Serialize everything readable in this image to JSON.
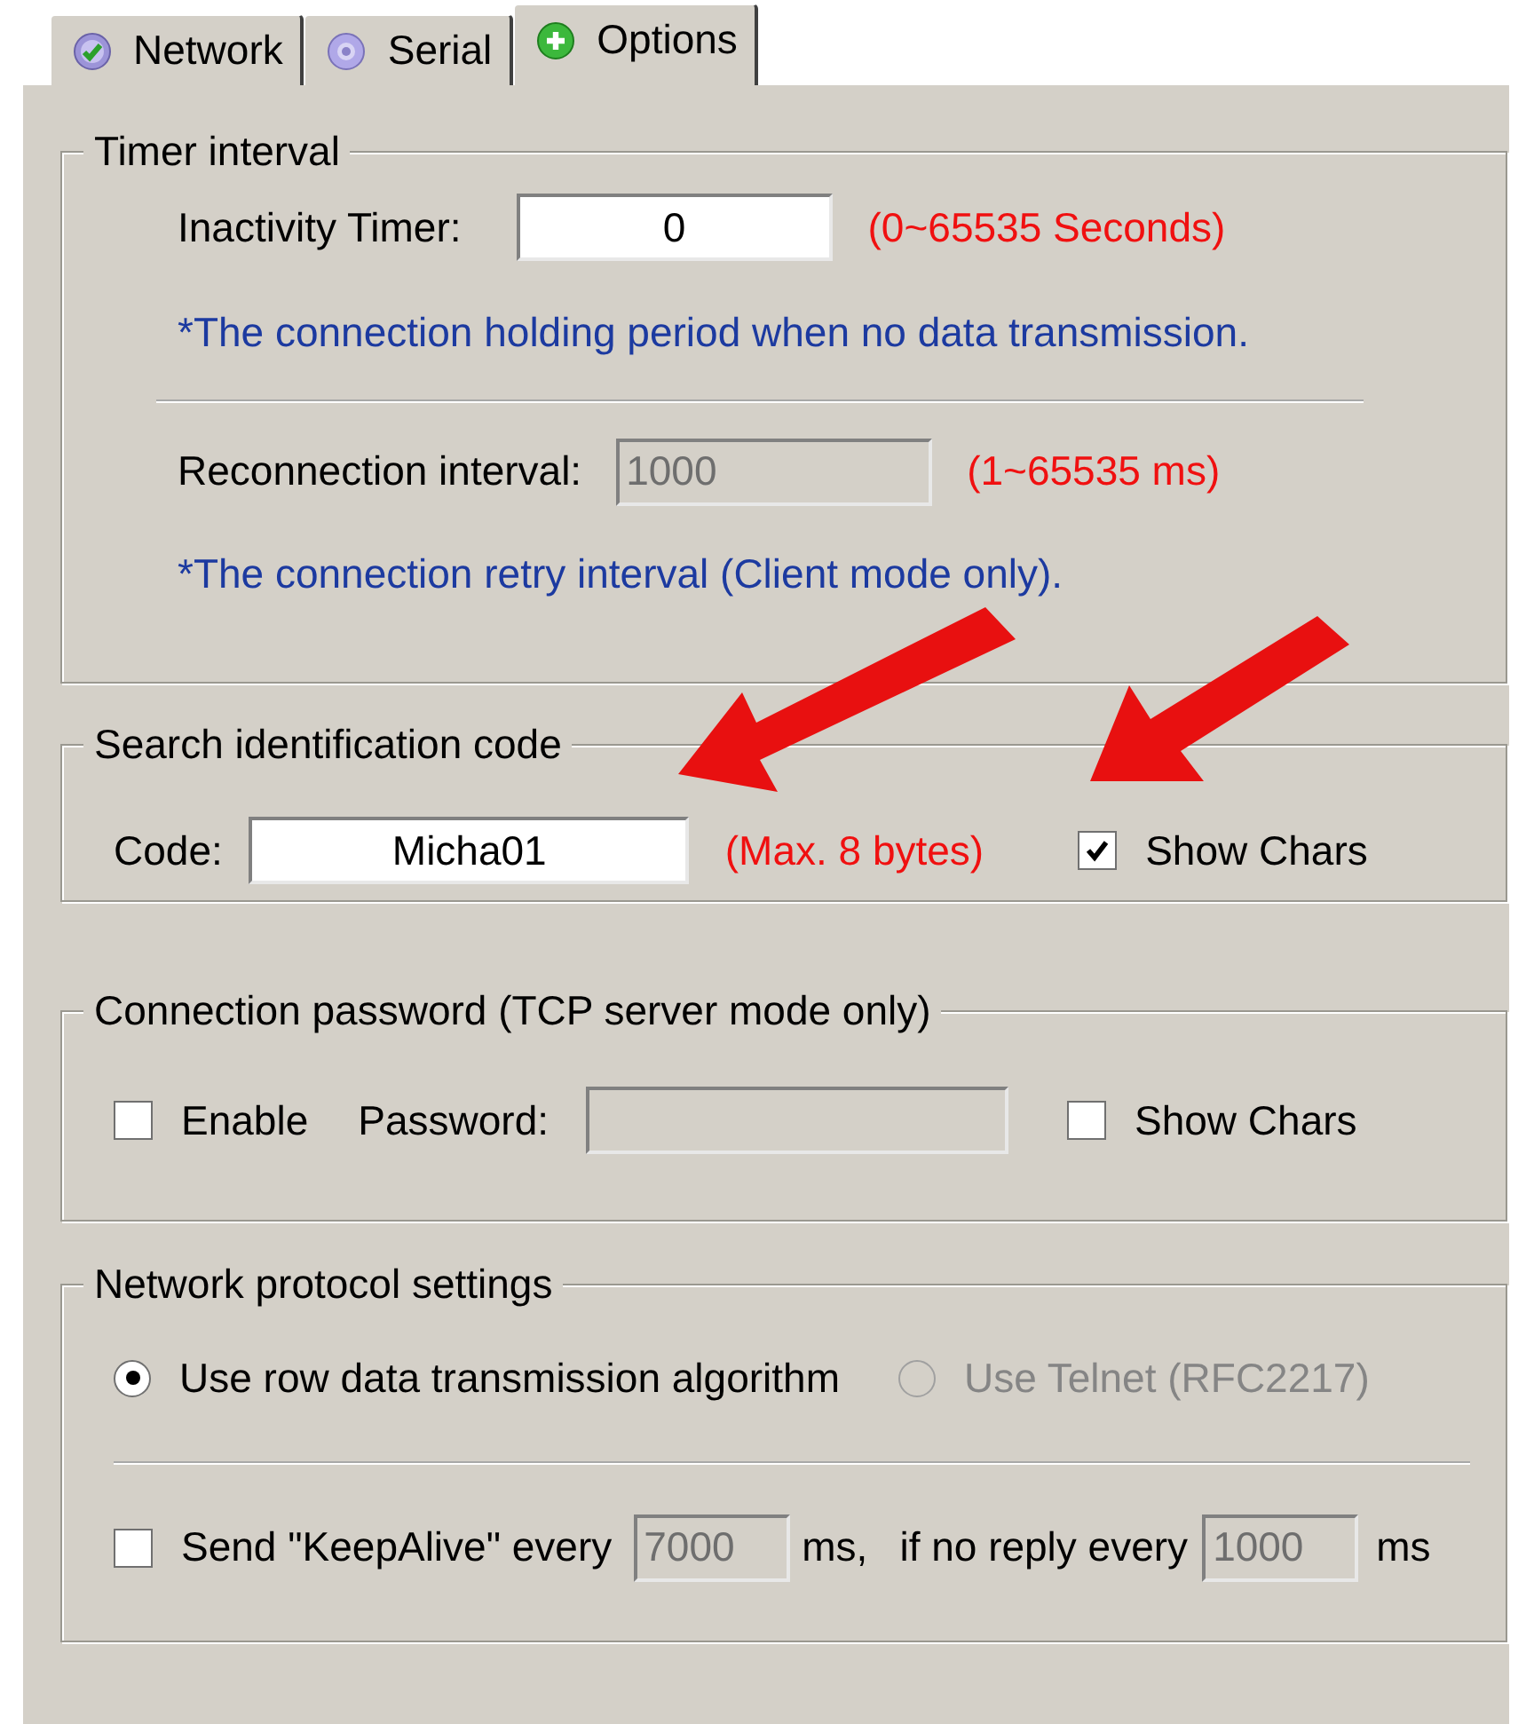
{
  "tabs": [
    {
      "label": "Network",
      "selected": false
    },
    {
      "label": "Serial",
      "selected": false
    },
    {
      "label": "Options",
      "selected": true
    }
  ],
  "sections": [
    {
      "title": "Timer interval",
      "rows": [
        {
          "kind": "fields",
          "items": [
            {
              "kind": "label",
              "text": "Inactivity Timer:"
            },
            {
              "kind": "input",
              "value": "0",
              "disabled": false
            },
            {
              "kind": "hint",
              "text": "(0~65535 Seconds)"
            }
          ]
        },
        {
          "kind": "note",
          "text": "*The connection holding period when no data transmission."
        },
        {
          "kind": "separator"
        },
        {
          "kind": "fields",
          "items": [
            {
              "kind": "label",
              "text": "Reconnection interval:"
            },
            {
              "kind": "input",
              "value": "1000",
              "disabled": true
            },
            {
              "kind": "hint",
              "text": "(1~65535 ms)"
            }
          ]
        },
        {
          "kind": "note",
          "text": "*The connection retry interval (Client mode only)."
        }
      ]
    },
    {
      "title": "Search identification code",
      "rows": [
        {
          "kind": "fields",
          "items": [
            {
              "kind": "label",
              "text": "Code:"
            },
            {
              "kind": "input",
              "value": "Micha01",
              "disabled": false
            },
            {
              "kind": "hint",
              "text": "(Max. 8 bytes)"
            },
            {
              "kind": "checkbox",
              "text": "Show Chars",
              "checked": true
            }
          ]
        }
      ]
    },
    {
      "title": "Connection password (TCP server mode only)",
      "rows": [
        {
          "kind": "fields",
          "items": [
            {
              "kind": "checkbox",
              "text": "Enable",
              "checked": false
            },
            {
              "kind": "label",
              "text": "Password:"
            },
            {
              "kind": "input",
              "disabled": true
            },
            {
              "kind": "checkbox",
              "text": "Show Chars",
              "checked": false
            }
          ]
        }
      ]
    },
    {
      "title": "Network protocol settings",
      "rows": [
        {
          "kind": "fields",
          "items": [
            {
              "kind": "radio",
              "text": "Use row data transmission algorithm",
              "selected": true,
              "disabled": false
            },
            {
              "kind": "radio",
              "text": "Use Telnet (RFC2217)",
              "selected": false,
              "disabled": true
            }
          ]
        },
        {
          "kind": "separator"
        },
        {
          "kind": "fields",
          "items": [
            {
              "kind": "checkbox",
              "text": "Send \"KeepAlive\" every",
              "checked": false
            },
            {
              "kind": "input",
              "value": "7000",
              "disabled": true
            },
            {
              "kind": "label",
              "text": "ms,"
            },
            {
              "kind": "label",
              "text": "if no reply every"
            },
            {
              "kind": "input",
              "value": "1000",
              "disabled": true
            },
            {
              "kind": "label",
              "text": "ms"
            }
          ]
        }
      ]
    }
  ]
}
